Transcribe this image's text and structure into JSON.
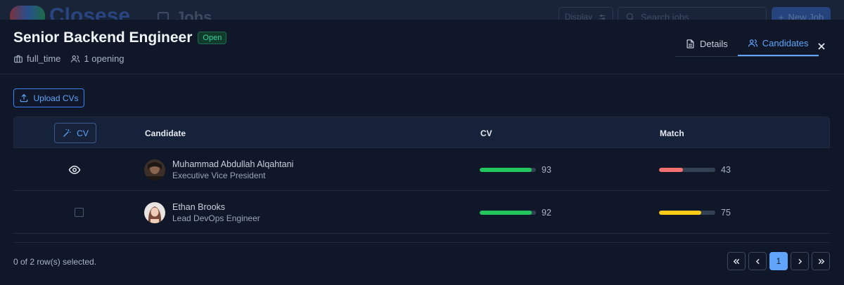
{
  "background": {
    "logo_text": "Closese",
    "page_label": "Jobs",
    "display_label": "Display",
    "search_placeholder": "Search jobs",
    "new_job_label": "New Job"
  },
  "job": {
    "title": "Senior Backend Engineer",
    "status": "Open",
    "employment_type": "full_time",
    "openings": "1 opening"
  },
  "tabs": [
    {
      "label": "Details",
      "icon": "document-icon",
      "active": false
    },
    {
      "label": "Candidates",
      "icon": "users-icon",
      "active": true
    }
  ],
  "upload_label": "Upload CVs",
  "table": {
    "cv_button_label": "CV",
    "columns": [
      "Candidate",
      "CV",
      "Match"
    ],
    "rows": [
      {
        "name": "Muhammad Abdullah Alqahtani",
        "role": "Executive Vice President",
        "cv": 93,
        "match": 43,
        "viewed": true
      },
      {
        "name": "Ethan Brooks",
        "role": "Lead DevOps Engineer",
        "cv": 92,
        "match": 75,
        "viewed": false
      }
    ]
  },
  "colors": {
    "accent": "#60a5fa",
    "bar_green": "#22c55e",
    "bar_red": "#f87171",
    "bar_yellow": "#facc15",
    "bar_track": "#334155"
  },
  "footer": {
    "selected_text": "0 of 2 row(s) selected.",
    "current_page": "1"
  }
}
